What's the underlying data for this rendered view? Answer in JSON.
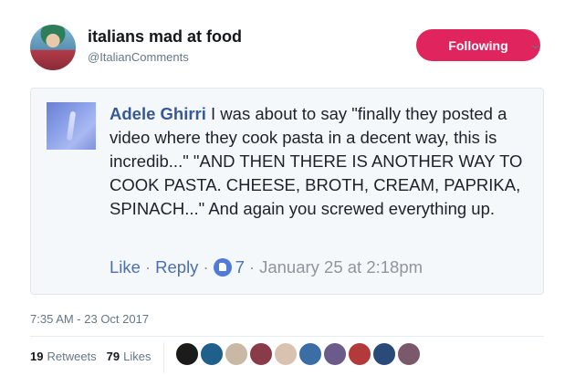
{
  "account": {
    "display_name": "italians mad at food",
    "handle": "@ItalianComments"
  },
  "follow_button": {
    "label": "Following"
  },
  "comment": {
    "author": "Adele Ghirri",
    "text": " I was about to say \"finally they posted a video where they cook pasta in a decent way, this is incredib...\" \"AND THEN THERE IS ANOTHER WAY TO COOK PASTA. CHEESE, BROTH, CREAM, PAPRIKA, SPINACH...\" And again you screwed everything up.",
    "actions": {
      "like": "Like",
      "reply": "Reply",
      "separator": "·",
      "like_count": "7",
      "date": "January 25 at 2:18pm"
    }
  },
  "tweet": {
    "timestamp": "7:35 AM - 23 Oct 2017",
    "retweets": {
      "count": "19",
      "label": "Retweets"
    },
    "likes": {
      "count": "79",
      "label": "Likes"
    }
  },
  "likers_colors": [
    "#1b1b1b",
    "#1f5f8b",
    "#c9b8a6",
    "#8a3b4a",
    "#d9c3b0",
    "#3a6ea5",
    "#6b5b8a",
    "#b33a3a",
    "#2a4a7a",
    "#7a5a6a"
  ],
  "icons": {
    "chevron": "chevron-down-icon",
    "like": "thumbs-up-icon"
  }
}
